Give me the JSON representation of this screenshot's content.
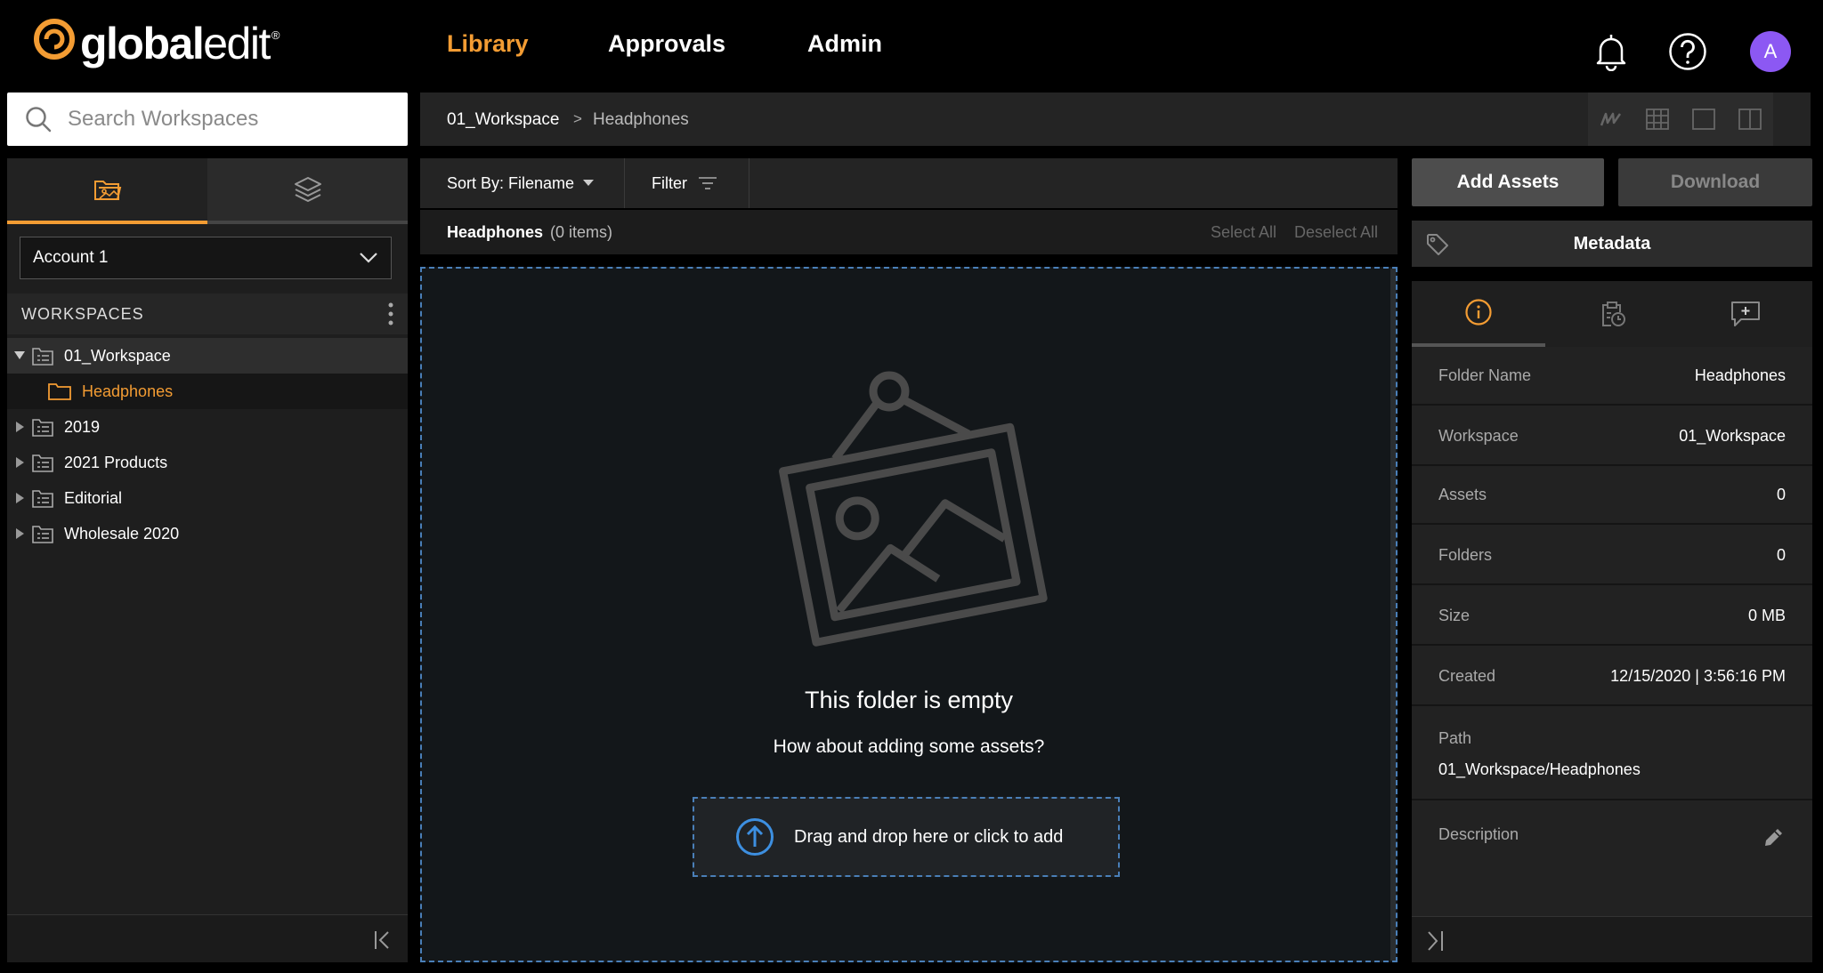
{
  "app": {
    "logo_text_bold": "global",
    "logo_text_light": "edit",
    "logo_reg": "®",
    "brand_color": "#f39c33",
    "avatar_color": "#8c58f3"
  },
  "nav": {
    "library": "Library",
    "approvals": "Approvals",
    "admin": "Admin",
    "active": "Library"
  },
  "user": {
    "avatar_initial": "A"
  },
  "search": {
    "placeholder": "Search Workspaces",
    "value": ""
  },
  "sidebar": {
    "account": "Account 1",
    "workspaces_header": "WORKSPACES",
    "tree": [
      {
        "label": "01_Workspace",
        "expanded": true
      },
      {
        "label": "Headphones",
        "selected": true
      },
      {
        "label": "2019"
      },
      {
        "label": "2021 Products"
      },
      {
        "label": "Editorial"
      },
      {
        "label": "Wholesale 2020"
      }
    ]
  },
  "breadcrumb": {
    "workspace": "01_Workspace",
    "separator": ">",
    "current": "Headphones"
  },
  "toolbar": {
    "sort_label": "Sort By: Filename",
    "filter_label": "Filter"
  },
  "list_header": {
    "title": "Headphones",
    "count": "(0 items)",
    "select_all": "Select All",
    "deselect_all": "Deselect All"
  },
  "empty_state": {
    "title": "This folder is empty",
    "subtitle": "How about adding some assets?",
    "upload_label": "Drag and drop here or click to add"
  },
  "actions": {
    "add_assets": "Add Assets",
    "download": "Download"
  },
  "metadata": {
    "title": "Metadata",
    "rows": {
      "folder_name": {
        "k": "Folder Name",
        "v": "Headphones"
      },
      "workspace": {
        "k": "Workspace",
        "v": "01_Workspace"
      },
      "assets": {
        "k": "Assets",
        "v": "0"
      },
      "folders": {
        "k": "Folders",
        "v": "0"
      },
      "size": {
        "k": "Size",
        "v": "0 MB"
      },
      "created": {
        "k": "Created",
        "v": "12/15/2020 | 3:56:16 PM"
      },
      "path": {
        "k": "Path",
        "v": "01_Workspace/Headphones"
      },
      "description": {
        "k": "Description",
        "v": ""
      }
    }
  }
}
